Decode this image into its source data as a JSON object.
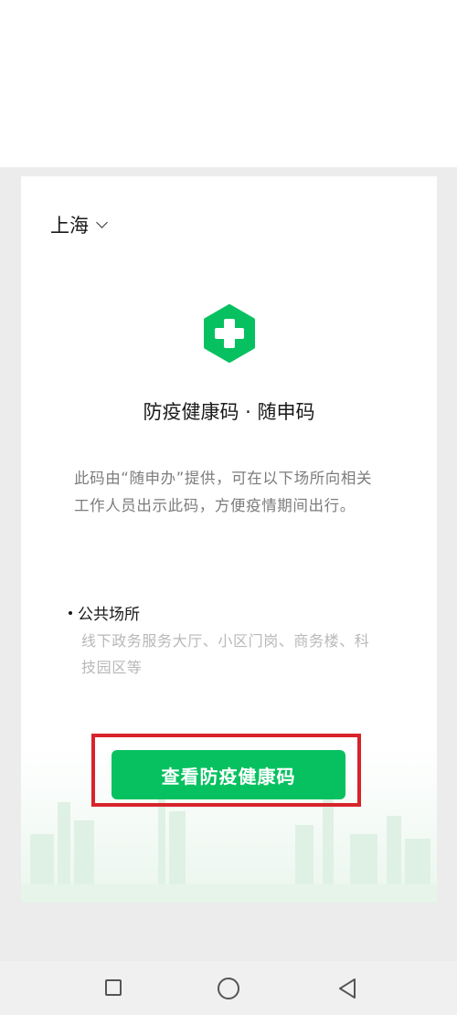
{
  "location": {
    "city": "上海"
  },
  "card": {
    "title": "防疫健康码 · 随申码",
    "description": "此码由“随申办”提供，可在以下场所向相关工作人员出示此码，方便疫情期间出行。",
    "section_title": "公共场所",
    "section_desc": "线下政务服务大厅、小区门岗、商务楼、科技园区等",
    "button_label": "查看防疫健康码"
  },
  "colors": {
    "brand_green": "#07c160",
    "highlight_red": "#d8232a"
  },
  "icons": {
    "logo": "health-cross-icon",
    "city_dropdown": "chevron-down-icon",
    "nav_recent": "square-icon",
    "nav_home": "circle-icon",
    "nav_back": "triangle-back-icon"
  }
}
